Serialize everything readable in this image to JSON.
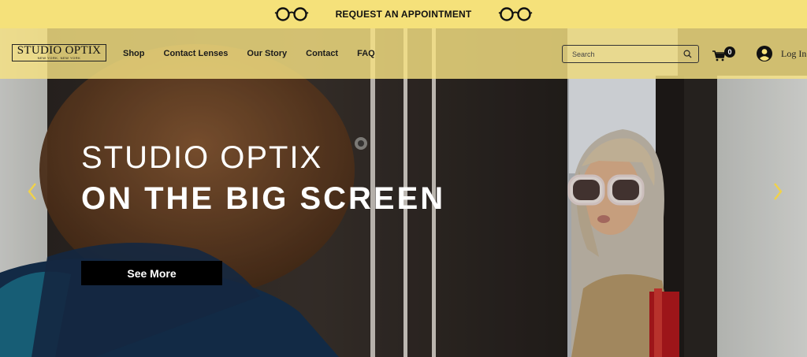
{
  "topbar": {
    "cta_label": "REQUEST AN APPOINTMENT",
    "left_icon": "glasses-icon",
    "right_icon": "glasses-icon",
    "background": "#f5e17a"
  },
  "header": {
    "logo_text": "STUDIO OPTIX",
    "logo_subtext": "NEW YORK, NEW YORK",
    "nav_items": [
      {
        "label": "Shop"
      },
      {
        "label": "Contact Lenses"
      },
      {
        "label": "Our Story"
      },
      {
        "label": "Contact"
      },
      {
        "label": "FAQ"
      }
    ],
    "search": {
      "placeholder": "Search",
      "icon": "search-icon"
    },
    "cart": {
      "count": "0",
      "icon": "cart-icon"
    },
    "login": {
      "label": "Log In",
      "icon": "avatar-icon"
    }
  },
  "hero": {
    "headline_line1": "STUDIO OPTIX",
    "headline_line2": "ON THE BIG SCREEN",
    "button_label": "See More",
    "prev_icon": "chevron-left-icon",
    "next_icon": "chevron-right-icon",
    "arrow_color": "#f0d24a"
  }
}
